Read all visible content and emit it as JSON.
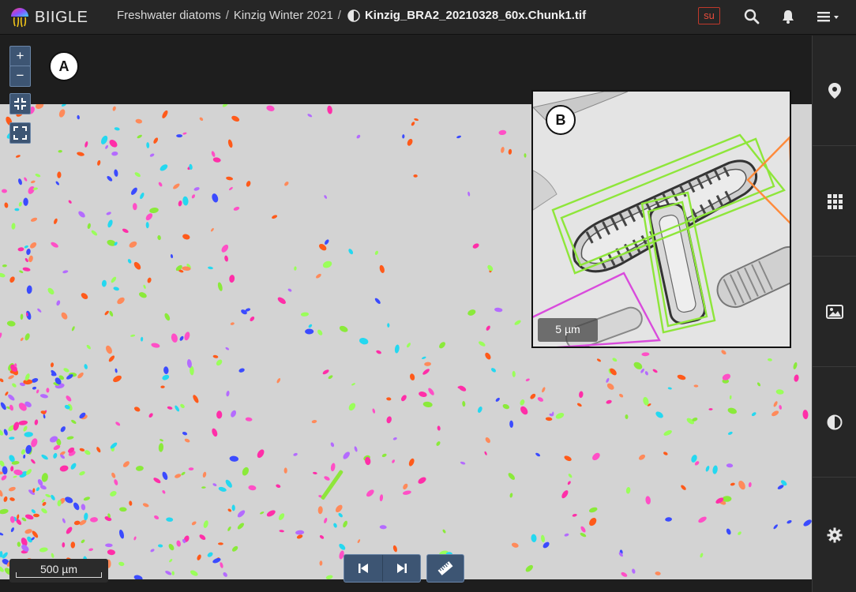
{
  "app": {
    "name": "BIIGLE"
  },
  "breadcrumb": {
    "project": "Freshwater diatoms",
    "volume": "Kinzig Winter 2021",
    "separator": "/",
    "filename": "Kinzig_BRA2_20210328_60x.Chunk1.tif"
  },
  "header": {
    "user_badge": "su"
  },
  "zoom": {
    "zoom_in_label": "+",
    "zoom_out_label": "−"
  },
  "panel_labels": {
    "main": "A",
    "inset": "B"
  },
  "scale": {
    "main_label": "500 µm",
    "inset_label": "5 µm"
  },
  "icons": {
    "logo": "biigle-jellyfish-logo",
    "search": "search-icon",
    "notifications": "bell-icon",
    "menu": "menu-icon",
    "sidebar": [
      "map-marker-icon",
      "grid-icon",
      "image-icon",
      "contrast-icon",
      "gear-icon"
    ],
    "bottom": [
      "previous-icon",
      "next-icon",
      "ruler-icon"
    ]
  },
  "colors": {
    "annotation": [
      "#ff4fc6",
      "#ff5a1a",
      "#8aea3a",
      "#24d8f0",
      "#3b4bff",
      "#b46bff",
      "#ff8a5a",
      "#ff2ea8",
      "#9aff5a"
    ],
    "accent_button": "#3d5573",
    "badge": "#e74c3c"
  }
}
